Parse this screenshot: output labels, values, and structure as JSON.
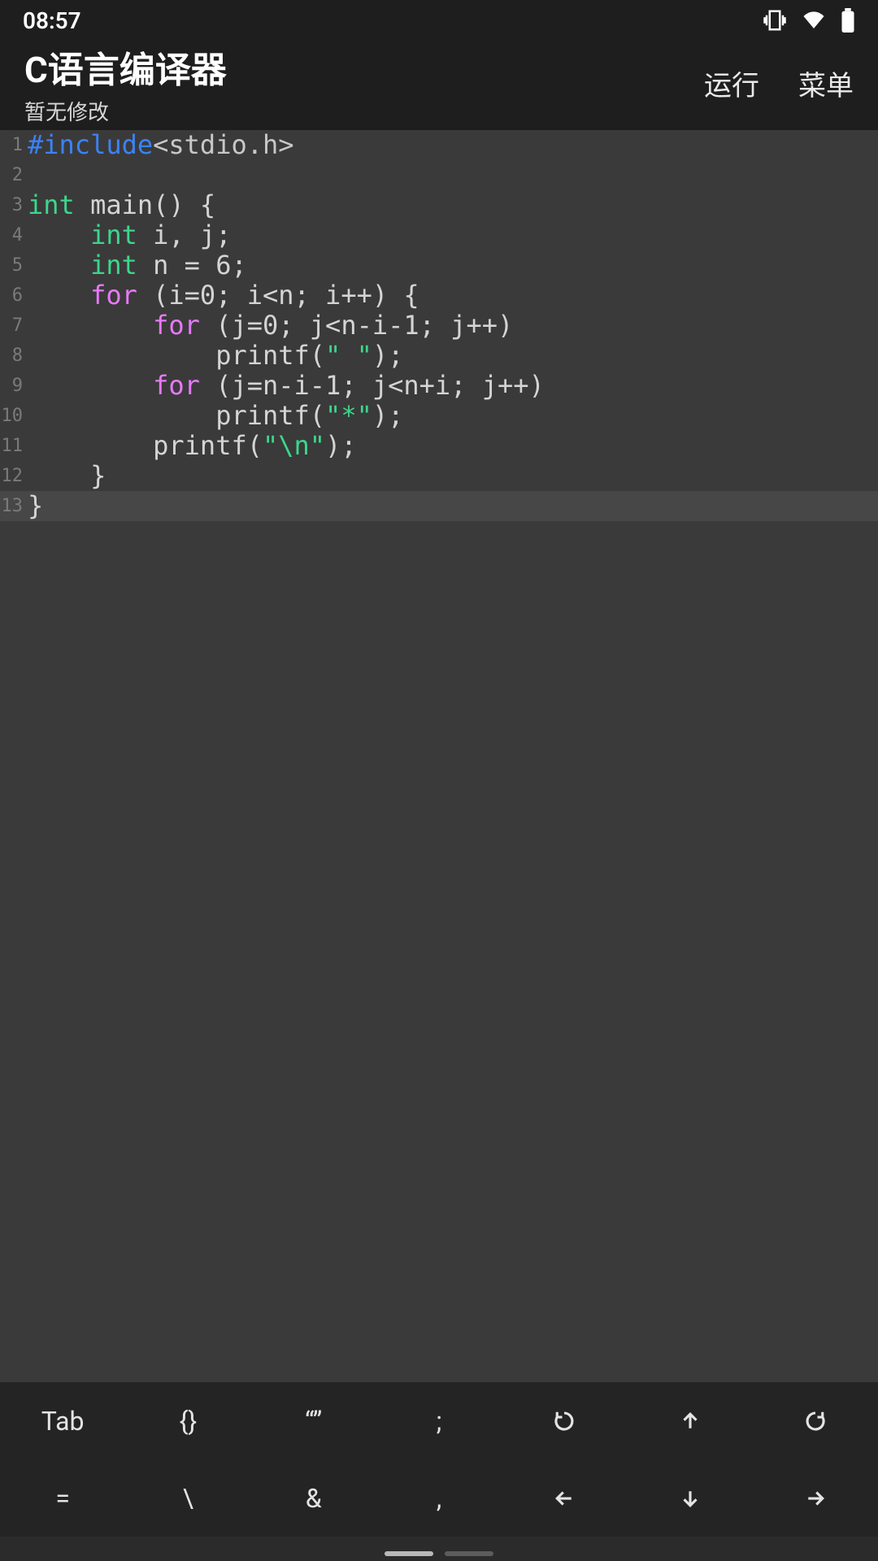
{
  "status": {
    "time": "08:57"
  },
  "appbar": {
    "title": "C语言编译器",
    "subtitle": "暂无修改",
    "run": "运行",
    "menu": "菜单"
  },
  "code": {
    "lines": [
      {
        "n": "1",
        "tokens": [
          {
            "c": "kw-pre",
            "t": "#include"
          },
          {
            "c": "punct",
            "t": "<stdio.h>"
          }
        ]
      },
      {
        "n": "2",
        "tokens": [
          {
            "c": "",
            "t": ""
          }
        ]
      },
      {
        "n": "3",
        "tokens": [
          {
            "c": "kw-type",
            "t": "int"
          },
          {
            "c": "",
            "t": " main() {"
          }
        ]
      },
      {
        "n": "4",
        "tokens": [
          {
            "c": "",
            "t": "    "
          },
          {
            "c": "kw-type",
            "t": "int"
          },
          {
            "c": "",
            "t": " i, j;"
          }
        ]
      },
      {
        "n": "5",
        "tokens": [
          {
            "c": "",
            "t": "    "
          },
          {
            "c": "kw-type",
            "t": "int"
          },
          {
            "c": "",
            "t": " n = 6;"
          }
        ]
      },
      {
        "n": "6",
        "tokens": [
          {
            "c": "",
            "t": "    "
          },
          {
            "c": "kw-stmt",
            "t": "for"
          },
          {
            "c": "",
            "t": " (i=0; i<n; i++) {"
          }
        ]
      },
      {
        "n": "7",
        "tokens": [
          {
            "c": "",
            "t": "        "
          },
          {
            "c": "kw-stmt",
            "t": "for"
          },
          {
            "c": "",
            "t": " (j=0; j<n-i-1; j++)"
          }
        ]
      },
      {
        "n": "8",
        "tokens": [
          {
            "c": "",
            "t": "            printf("
          },
          {
            "c": "str",
            "t": "\" \""
          },
          {
            "c": "",
            "t": ");"
          }
        ]
      },
      {
        "n": "9",
        "tokens": [
          {
            "c": "",
            "t": "        "
          },
          {
            "c": "kw-stmt",
            "t": "for"
          },
          {
            "c": "",
            "t": " (j=n-i-1; j<n+i; j++)"
          }
        ]
      },
      {
        "n": "10",
        "tokens": [
          {
            "c": "",
            "t": "            printf("
          },
          {
            "c": "str",
            "t": "\"*\""
          },
          {
            "c": "",
            "t": ");"
          }
        ]
      },
      {
        "n": "11",
        "tokens": [
          {
            "c": "",
            "t": "        printf("
          },
          {
            "c": "str",
            "t": "\"\\n\""
          },
          {
            "c": "",
            "t": ");"
          }
        ]
      },
      {
        "n": "12",
        "tokens": [
          {
            "c": "",
            "t": "    }"
          }
        ]
      },
      {
        "n": "13",
        "tokens": [
          {
            "c": "",
            "t": "}"
          }
        ],
        "current": true
      }
    ]
  },
  "keys": {
    "row1": [
      "Tab",
      "{}",
      "“”",
      ";",
      "undo-icon",
      "arrow-up-icon",
      "redo-icon"
    ],
    "row2": [
      "=",
      "\\",
      "&",
      ",",
      "arrow-left-icon",
      "arrow-down-icon",
      "arrow-right-icon"
    ]
  }
}
